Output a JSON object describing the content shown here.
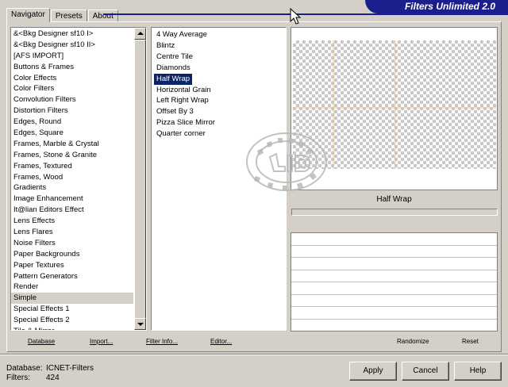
{
  "app_title": "Filters Unlimited 2.0",
  "tabs": [
    {
      "label": "Navigator",
      "active": true
    },
    {
      "label": "Presets",
      "active": false
    },
    {
      "label": "About",
      "active": false
    }
  ],
  "categories": [
    "&<Bkg Designer sf10 I>",
    "&<Bkg Designer sf10 II>",
    "[AFS IMPORT]",
    "Buttons & Frames",
    "Color Effects",
    "Color Filters",
    "Convolution Filters",
    "Distortion Filters",
    "Edges, Round",
    "Edges, Square",
    "Frames, Marble & Crystal",
    "Frames, Stone & Granite",
    "Frames, Textured",
    "Frames, Wood",
    "Gradients",
    "Image Enhancement",
    "It@lian Editors Effect",
    "Lens Effects",
    "Lens Flares",
    "Noise Filters",
    "Paper Backgrounds",
    "Paper Textures",
    "Pattern Generators",
    "Render",
    "Simple",
    "Special Effects 1",
    "Special Effects 2",
    "Tile & Mirror"
  ],
  "selected_category": "Simple",
  "filters": [
    "4 Way Average",
    "Blintz",
    "Centre Tile",
    "Diamonds",
    "Half Wrap",
    "Horizontal Grain",
    "Left Right Wrap",
    "Offset By 3",
    "Pizza Slice Mirror",
    "Quarter corner"
  ],
  "selected_filter": "Half Wrap",
  "preview_label": "Half Wrap",
  "progress": 0,
  "toolbar": {
    "database": "Database",
    "import": "Import...",
    "filter_info": "Filter Info...",
    "editor": "Editor...",
    "randomize": "Randomize",
    "reset": "Reset"
  },
  "status": {
    "database_label": "Database:",
    "database_value": "ICNET-Filters",
    "filters_label": "Filters:",
    "filters_value": "424"
  },
  "buttons": {
    "apply": "Apply",
    "cancel": "Cancel",
    "help": "Help"
  },
  "colors": {
    "banner": "#1a1f8c",
    "selection": "#0a246a",
    "face": "#d4d0c8"
  }
}
